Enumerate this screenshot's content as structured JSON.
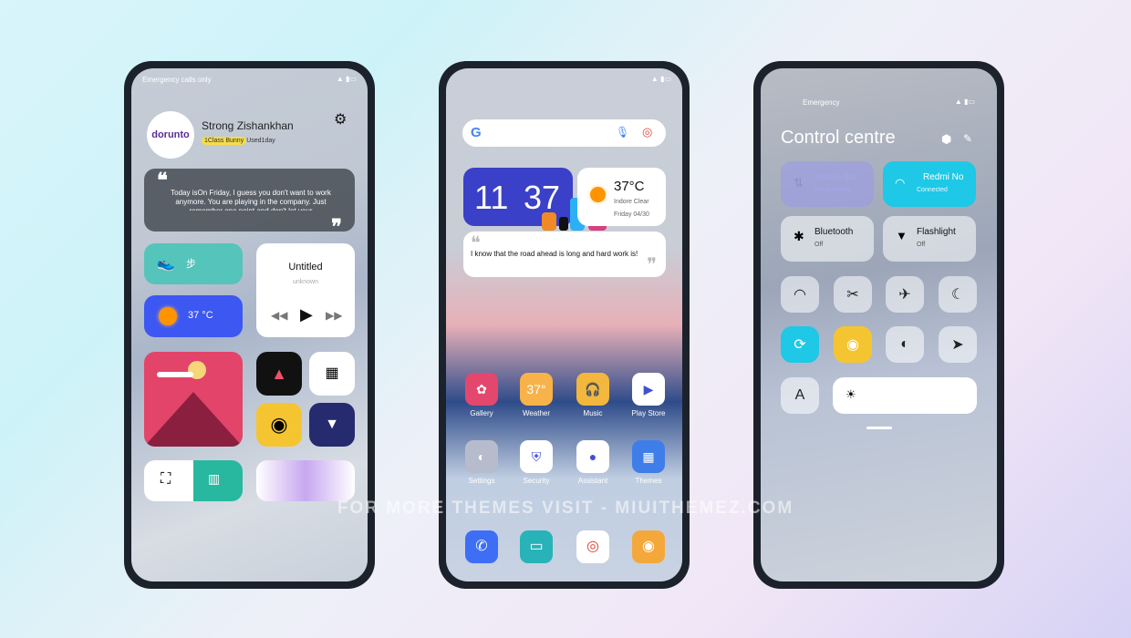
{
  "left": {
    "status": "Emergency calls only",
    "avatar_logo": "dorunto",
    "name": "Strong Zishankhan",
    "badge": "1Class Bunny",
    "badge_suffix": "Used1day",
    "quote": "Today isOn Friday, I guess you don't want to work anymore. You are playing in the company. Just remember one point and don't let your",
    "steps": "步",
    "temp": "37 °C",
    "music_title": "Untitled",
    "music_artist": "unknown"
  },
  "middle": {
    "clock_h": "11",
    "clock_m": "37",
    "weather_temp": "37°C",
    "weather_desc": "Indore Clear",
    "weather_date": "Friday 04/30",
    "quote": "I know that the road ahead is long and hard work is!",
    "apps": [
      {
        "label": "Gallery",
        "color": "#e4476d"
      },
      {
        "label": "Weather",
        "color": "#f7b24a"
      },
      {
        "label": "Music",
        "color": "#f2b73c"
      },
      {
        "label": "Play Store",
        "color": "#ffffff"
      },
      {
        "label": "Settings",
        "color": "#b6bccb"
      },
      {
        "label": "Security",
        "color": "#ffffff"
      },
      {
        "label": "Assistant",
        "color": "#ffffff"
      },
      {
        "label": "Themes",
        "color": "#3f7ee8"
      }
    ],
    "dock": [
      {
        "icon": "phone-icon",
        "color": "#3d6ef5"
      },
      {
        "icon": "messages-icon",
        "color": "#27b3b8"
      },
      {
        "icon": "chrome-icon",
        "color": "#ffffff"
      },
      {
        "icon": "camera-icon",
        "color": "#f4a83c"
      }
    ]
  },
  "right": {
    "status": "Emergency",
    "title": "Control centre",
    "tiles": [
      {
        "title": "Mobile dat",
        "sub": "Not available"
      },
      {
        "title": "Redmi No",
        "sub": "Connected"
      },
      {
        "title": "Bluetooth",
        "sub": "Off"
      },
      {
        "title": "Flashlight",
        "sub": "Off"
      }
    ],
    "font_button": "A",
    "accent": "#1ec8e6"
  },
  "watermark": "FOR MORE THEMES VISIT - MIUITHEMEZ.COM"
}
